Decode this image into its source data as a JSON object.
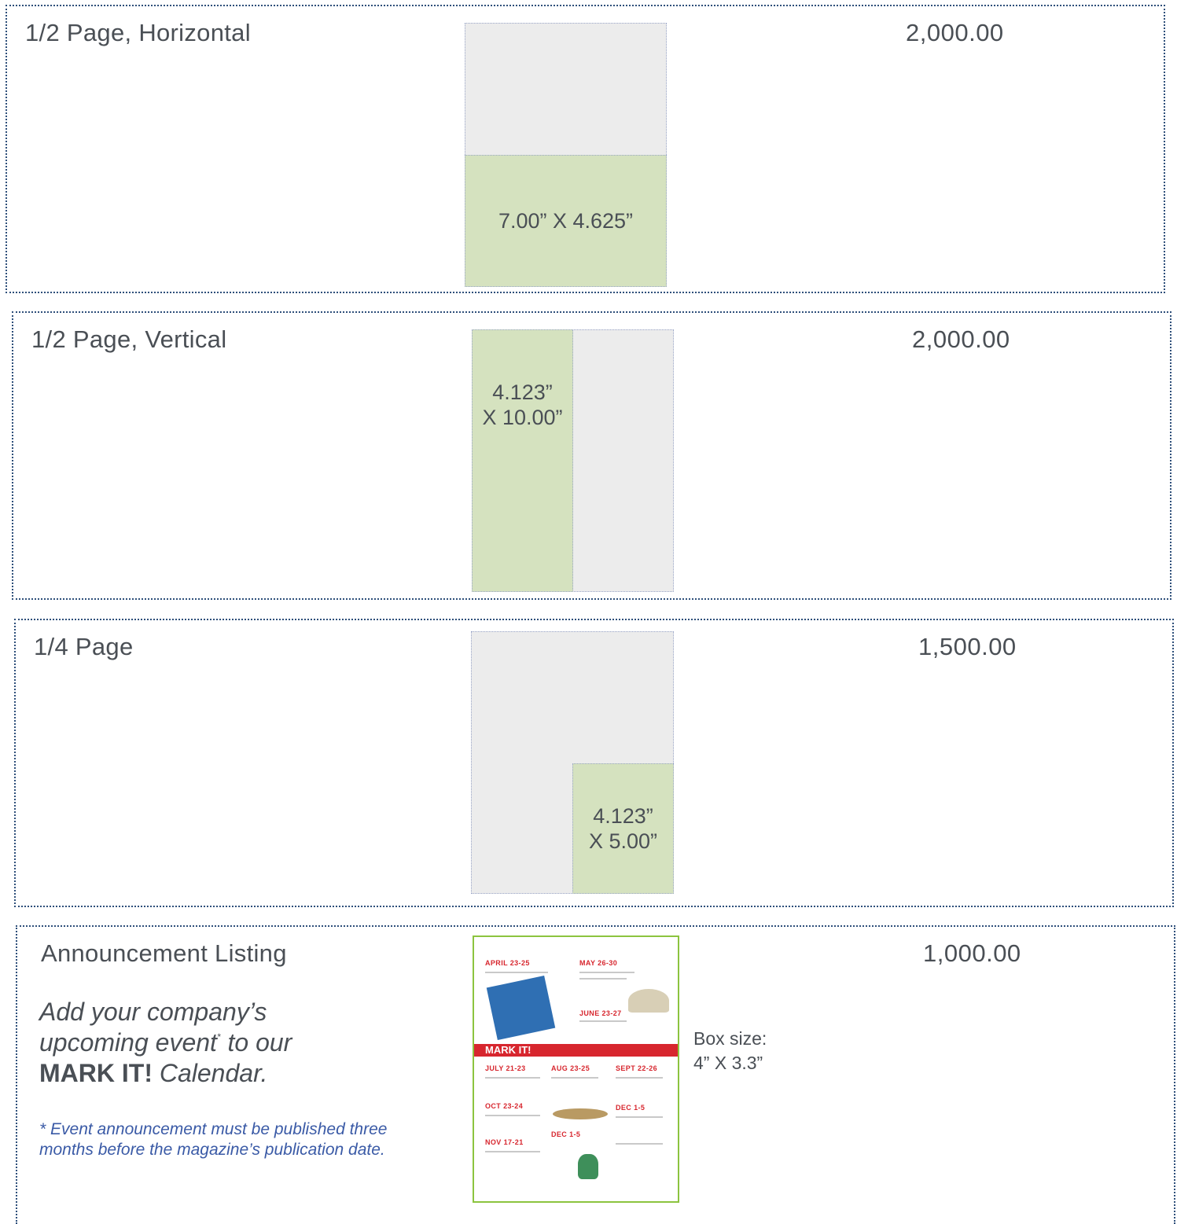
{
  "rows": [
    {
      "label": "1/2 Page, Horizontal",
      "price": "2,000.00",
      "ad_size": "7.00” X 4.625”"
    },
    {
      "label": "1/2 Page, Vertical",
      "price": "2,000.00",
      "ad_size_line1": "4.123”",
      "ad_size_line2": "X 10.00”"
    },
    {
      "label": "1/4 Page",
      "price": "1,500.00",
      "ad_size_line1": "4.123”",
      "ad_size_line2": "X 5.00”"
    }
  ],
  "announcement": {
    "label": "Announcement Listing",
    "price": "1,000.00",
    "promo_line1": "Add your company’s",
    "promo_line2_pre": "upcoming event",
    "promo_mark": "*",
    "promo_line2_post": " to our",
    "promo_bold": "MARK IT!",
    "promo_tail": " Calendar.",
    "footnote": "* Event announcement must be published three months before the magazine’s publication date.",
    "box_size_label": "Box size:",
    "box_size_value": "4” X 3.3”",
    "thumbnail": {
      "banner": "MARK IT!",
      "dates": [
        "APRIL 23-25",
        "MAY 26-30",
        "JUNE 23-27",
        "JULY 21-23",
        "AUG 23-25",
        "SEPT 22-26",
        "OCT 23-24",
        "DEC 1-5",
        "NOV 17-21",
        "DEC 1-5"
      ]
    }
  },
  "colors": {
    "row_border": "#2e4f7a",
    "ad_fill": "#d5e2bf",
    "page_fill": "#ececec",
    "footnote": "#3a5aa6",
    "banner": "#d7262e",
    "thumb_border": "#8cc43f"
  }
}
